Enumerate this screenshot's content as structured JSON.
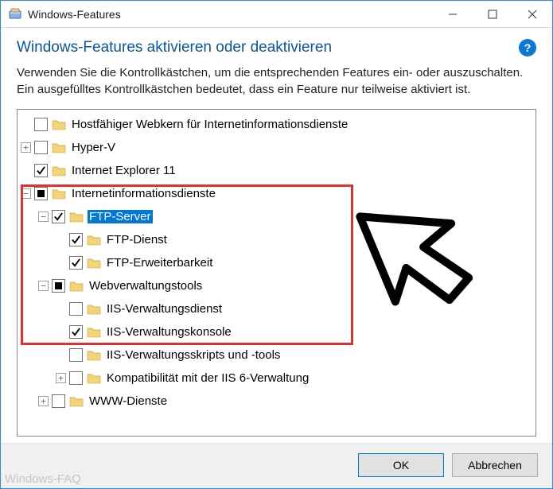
{
  "window": {
    "title": "Windows-Features"
  },
  "header": {
    "heading": "Windows-Features aktivieren oder deaktivieren",
    "help_tooltip": "?"
  },
  "description": "Verwenden Sie die Kontrollkästchen, um die entsprechenden Features ein- oder auszuschalten. Ein ausgefülltes Kontrollkästchen bedeutet, dass ein Feature nur teilweise aktiviert ist.",
  "tree": [
    {
      "label": "Hostfähiger Webkern für Internetinformationsdienste",
      "depth": 0,
      "expander": "none",
      "check": "unchecked",
      "selected": false
    },
    {
      "label": "Hyper-V",
      "depth": 0,
      "expander": "plus",
      "check": "unchecked",
      "selected": false
    },
    {
      "label": "Internet Explorer 11",
      "depth": 0,
      "expander": "none",
      "check": "checked",
      "selected": false
    },
    {
      "label": "Internetinformationsdienste",
      "depth": 0,
      "expander": "minus",
      "check": "partial",
      "selected": false
    },
    {
      "label": "FTP-Server",
      "depth": 1,
      "expander": "minus",
      "check": "checked",
      "selected": true
    },
    {
      "label": "FTP-Dienst",
      "depth": 2,
      "expander": "none",
      "check": "checked",
      "selected": false
    },
    {
      "label": "FTP-Erweiterbarkeit",
      "depth": 2,
      "expander": "none",
      "check": "checked",
      "selected": false
    },
    {
      "label": "Webverwaltungstools",
      "depth": 1,
      "expander": "minus",
      "check": "partial",
      "selected": false
    },
    {
      "label": "IIS-Verwaltungsdienst",
      "depth": 2,
      "expander": "none",
      "check": "unchecked",
      "selected": false
    },
    {
      "label": "IIS-Verwaltungskonsole",
      "depth": 2,
      "expander": "none",
      "check": "checked",
      "selected": false
    },
    {
      "label": "IIS-Verwaltungsskripts und -tools",
      "depth": 2,
      "expander": "none",
      "check": "unchecked",
      "selected": false
    },
    {
      "label": "Kompatibilität mit der IIS 6-Verwaltung",
      "depth": 2,
      "expander": "plus",
      "check": "unchecked",
      "selected": false
    },
    {
      "label": "WWW-Dienste",
      "depth": 1,
      "expander": "plus",
      "check": "unchecked",
      "selected": false
    }
  ],
  "buttons": {
    "ok": "OK",
    "cancel": "Abbrechen"
  },
  "watermark": "Windows-FAQ",
  "colors": {
    "heading": "#0a55a6",
    "selection": "#0078d7",
    "callout": "#e03030"
  }
}
